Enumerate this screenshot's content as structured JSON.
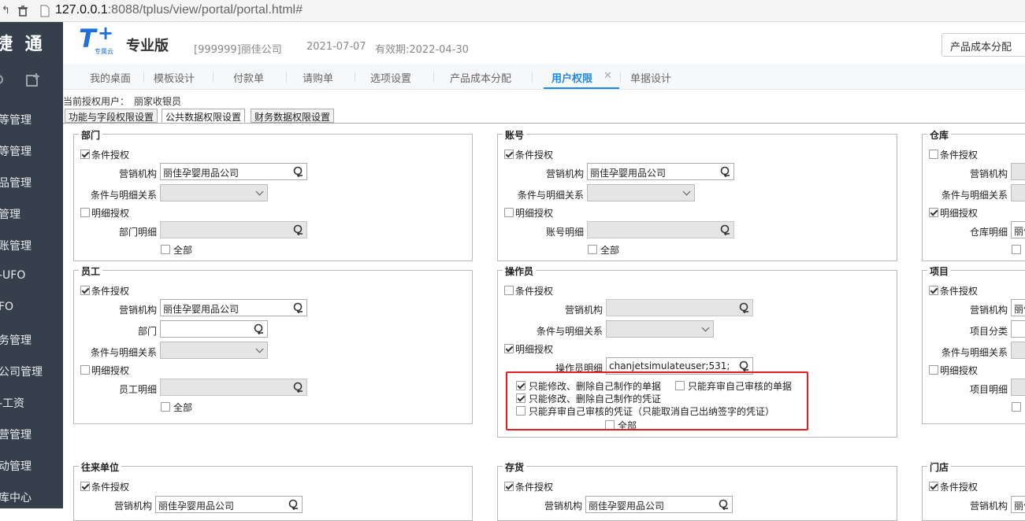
{
  "browser": {
    "host": "127.0.0.1",
    "port_path": ":8088/tplus/view/portal/portal.html#"
  },
  "sidebar": {
    "brand": "捷 通",
    "items": [
      "等管理",
      "等管理",
      "品管理",
      "管理",
      "账管理",
      "-UFO",
      "FO",
      "务管理",
      "公司管理",
      "-工资",
      "营管理",
      "动管理",
      "库中心"
    ]
  },
  "header": {
    "logo_small": "专属云",
    "edition": "专业版",
    "company": "[999999]丽佳公司",
    "date": "2021-07-07",
    "validity": "有效期:2022-04-30",
    "right_button": "产品成本分配"
  },
  "tabs": [
    {
      "label": "我的桌面",
      "active": false
    },
    {
      "label": "模板设计",
      "active": false
    },
    {
      "label": "付款单",
      "active": false
    },
    {
      "label": "请购单",
      "active": false
    },
    {
      "label": "选项设置",
      "active": false
    },
    {
      "label": "产品成本分配",
      "active": false
    },
    {
      "label": "用户权限",
      "active": true
    },
    {
      "label": "单据设计",
      "active": false
    }
  ],
  "current_user": {
    "label": "当前授权用户：",
    "name": "丽家收银员"
  },
  "subtabs": [
    "功能与字段权限设置",
    "公共数据权限设置",
    "财务数据权限设置"
  ],
  "common": {
    "cond": "条件授权",
    "detail": "明细授权",
    "all": "全部",
    "org": "营销机构",
    "relation": "条件与明细关系",
    "org_value": "丽佳孕婴用品公司"
  },
  "groups": {
    "dept": {
      "title": "部门",
      "detail_label": "部门明细"
    },
    "account": {
      "title": "账号",
      "detail_label": "账号明细"
    },
    "warehouse": {
      "title": "仓库",
      "detail_label": "仓库明细",
      "detail_value": "丽佳"
    },
    "employee": {
      "title": "员工",
      "dept_label": "部门",
      "detail_label": "员工明细"
    },
    "operator": {
      "title": "操作员",
      "detail_label": "操作员明细",
      "detail_value": "chanjetsimulateuser;531;",
      "opt1": "只能修改、删除自己制作的单据",
      "opt2": "只能弃审自己审核的单据",
      "opt3": "只能修改、删除自己制作的凭证",
      "opt4": "只能弃审自己审核的凭证（只能取消自己出纳签字的凭证）"
    },
    "project": {
      "title": "项目",
      "category": "项目分类",
      "detail_label": "项目明细",
      "org_value": "丽佳"
    },
    "partner": {
      "title": "往来单位"
    },
    "inventory": {
      "title": "存货"
    },
    "store": {
      "title": "门店",
      "org_value": "丽佳"
    }
  },
  "colors": {
    "accent": "#1e88e5",
    "sidebar_bg": "#36404d",
    "highlight_box": "#e02020"
  }
}
